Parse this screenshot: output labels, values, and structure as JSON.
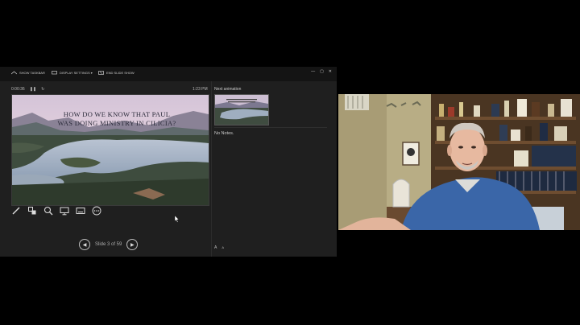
{
  "toolbar": {
    "show_taskbar": "SHOW TASKBAR",
    "display_settings": "DISPLAY SETTINGS ▾",
    "end_show": "END SLIDE SHOW",
    "window_buttons": [
      "—",
      "▢",
      "✕"
    ]
  },
  "timer": {
    "elapsed": "0:00:36",
    "pause_icon": "pause-icon",
    "reset_icon": "reset-icon"
  },
  "clock": "1:23 PM",
  "current_slide": {
    "title_line1": "HOW DO WE KNOW THAT PAUL",
    "title_line2": "WAS DOING MINISTRY IN CILICIA?"
  },
  "tools": [
    "pen-icon",
    "laser-pointer-icon",
    "zoom-icon",
    "monitor-icon",
    "subtitles-icon",
    "more-icon"
  ],
  "next_label": "Next animation",
  "notes": "No Notes.",
  "navigation": {
    "counter": "Slide 3 of 59",
    "prev": "◀",
    "next": "▶"
  },
  "font_controls": [
    "A",
    "A"
  ],
  "colors": {
    "panel": "#1f1f1f",
    "toolbar": "#141414",
    "background": "#000000"
  }
}
